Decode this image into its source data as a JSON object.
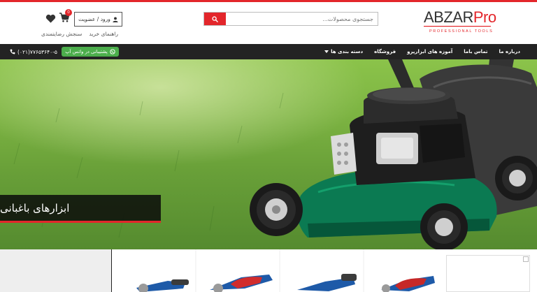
{
  "header": {
    "logo_main_a": "ABZAR",
    "logo_main_b": "Pro",
    "logo_sub": "PROFESSIONAL TOOLS",
    "search_placeholder": "جستجوی محصولات...",
    "cart_count": "0",
    "login_label": "ورود / عضویت",
    "links": [
      "راهنمای خرید",
      "سنجش رضایتمندی"
    ]
  },
  "nav": {
    "items": [
      "دسته بندی ها",
      "فروشگاه",
      "آموزه های ابزارپرو",
      "تماس باما",
      "درباره ما"
    ],
    "whatsapp_label": "پشتیبانی در واتس آپ",
    "phone": "(۰۲۱)۷۷۶۵۳۶۴۰-۵"
  },
  "hero": {
    "caption": "ابزارهای باغبانی"
  },
  "colors": {
    "accent": "#e3262b",
    "nav_bg": "#232323",
    "whatsapp": "#4cae4c"
  },
  "icons": [
    "search-icon",
    "cart-icon",
    "heart-icon",
    "user-icon",
    "whatsapp-icon",
    "phone-icon",
    "chevron-down-icon"
  ]
}
